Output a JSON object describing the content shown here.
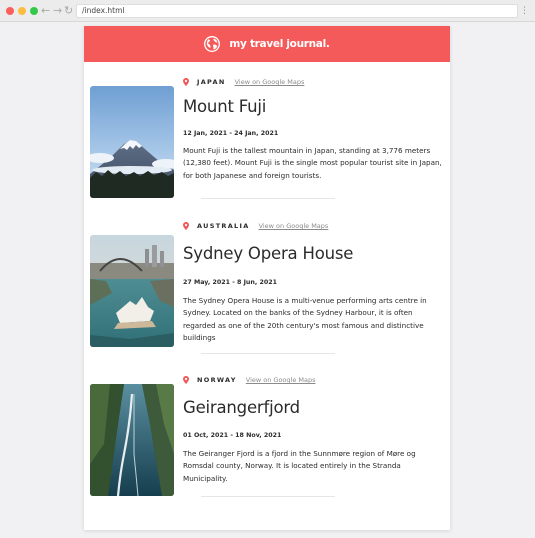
{
  "browser": {
    "url": "/index.html",
    "back_icon": "arrow-left-icon",
    "forward_icon": "arrow-right-icon",
    "reload_icon": "reload-icon",
    "menu_icon": "kebab-menu-icon"
  },
  "header": {
    "brand": "my travel journal.",
    "icon": "globe-icon",
    "background": "#f55a5a"
  },
  "entries": [
    {
      "country": "Japan",
      "map_link": "View on Google Maps",
      "title": "Mount Fuji",
      "dates": "12 Jan, 2021 - 24 Jan, 2021",
      "description": "Mount Fuji is the tallest mountain in Japan, standing at 3,776 meters (12,380 feet). Mount Fuji is the single most popular tourist site in Japan, for both Japanese and foreign tourists."
    },
    {
      "country": "Australia",
      "map_link": "View on Google Maps",
      "title": "Sydney Opera House",
      "dates": "27 May, 2021 - 8 Jun, 2021",
      "description": "The Sydney Opera House is a multi-venue performing arts centre in Sydney. Located on the banks of the Sydney Harbour, it is often regarded as one of the 20th century's most famous and distinctive buildings"
    },
    {
      "country": "Norway",
      "map_link": "View on Google Maps",
      "title": "Geirangerfjord",
      "dates": "01 Oct, 2021 - 18 Nov, 2021",
      "description": "The Geiranger Fjord is a fjord in the Sunnmøre region of Møre og Romsdal county, Norway. It is located entirely in the Stranda Municipality."
    }
  ]
}
